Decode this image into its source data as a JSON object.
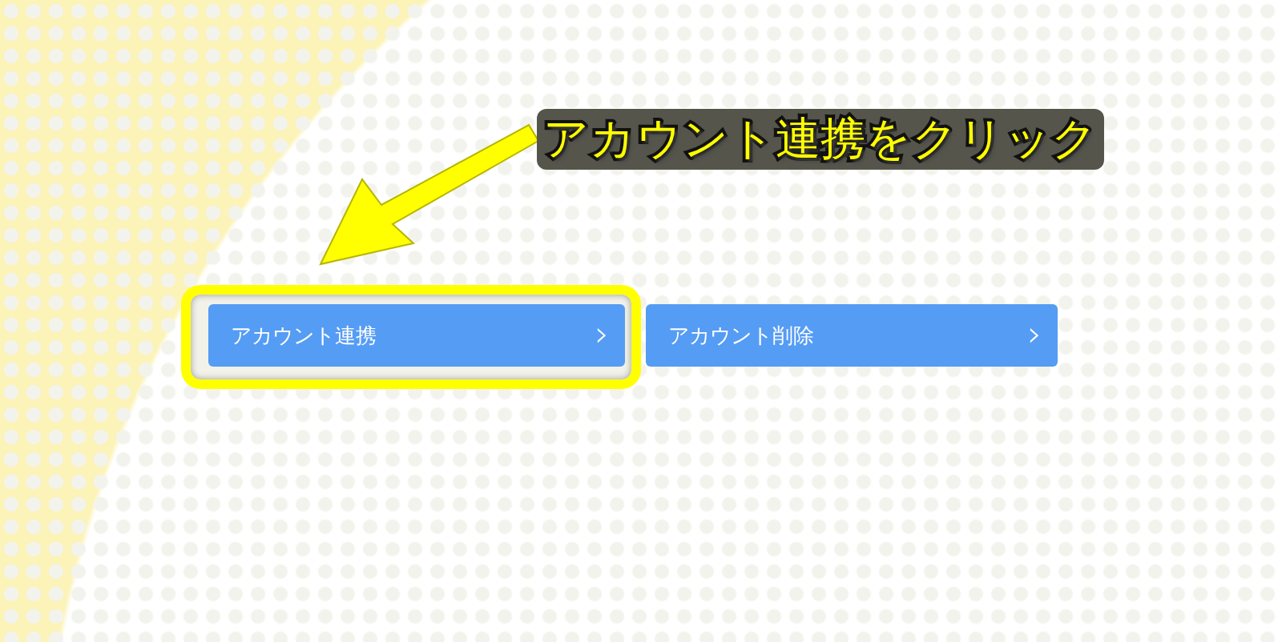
{
  "annotation": {
    "text": "アカウント連携をクリック"
  },
  "buttons": [
    {
      "label": "アカウント連携",
      "chevron": "›",
      "highlighted": true
    },
    {
      "label": "アカウント削除",
      "chevron": "›",
      "highlighted": false
    }
  ]
}
